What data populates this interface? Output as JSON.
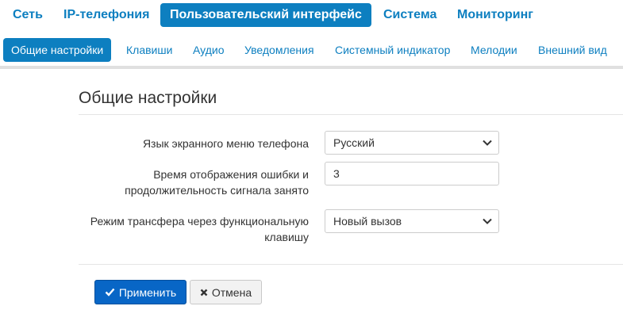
{
  "top_nav": {
    "tabs": [
      {
        "label": "Сеть"
      },
      {
        "label": "IP-телефония"
      },
      {
        "label": "Пользовательский интерфейс",
        "active": true
      },
      {
        "label": "Система"
      },
      {
        "label": "Мониторинг"
      }
    ]
  },
  "sub_nav": {
    "tabs": [
      {
        "label": "Общие настройки",
        "active": true
      },
      {
        "label": "Клавиши"
      },
      {
        "label": "Аудио"
      },
      {
        "label": "Уведомления"
      },
      {
        "label": "Системный индикатор"
      },
      {
        "label": "Мелодии"
      },
      {
        "label": "Внешний вид"
      }
    ]
  },
  "section": {
    "title": "Общие настройки"
  },
  "form": {
    "language": {
      "label": "Язык экранного меню телефона",
      "value": "Русский"
    },
    "error_time": {
      "label": "Время отображения ошибки и продолжительность сигнала занято",
      "value": "3"
    },
    "transfer_mode": {
      "label": "Режим трансфера через функциональную клавишу",
      "value": "Новый вызов"
    }
  },
  "buttons": {
    "apply_label": "Применить",
    "cancel_label": "Отмена"
  },
  "icons": {
    "apply": "check-icon",
    "cancel": "times-icon",
    "select": "chevron-down-icon"
  },
  "colors": {
    "accent": "#0d7fc0",
    "primary_button": "#0866c6",
    "divider": "#e0e0e0"
  }
}
